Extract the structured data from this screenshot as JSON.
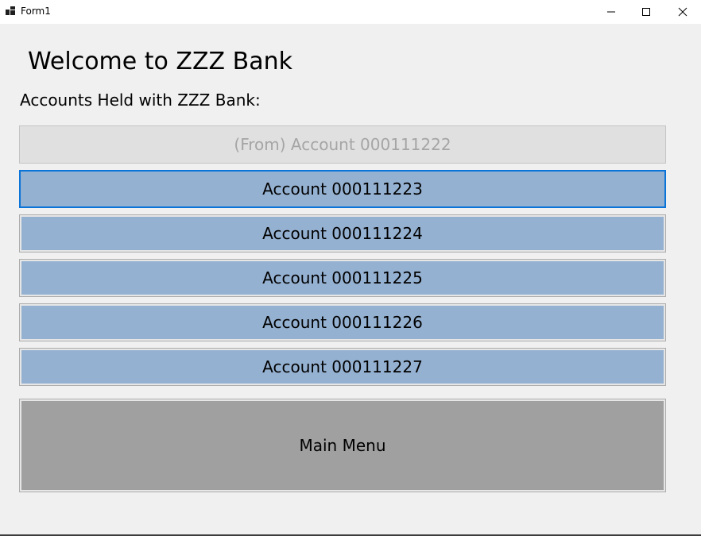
{
  "window": {
    "title": "Form1",
    "controls": {
      "minimize_icon": "minimize-icon",
      "maximize_icon": "maximize-icon",
      "close_icon": "close-icon"
    }
  },
  "main": {
    "heading": "Welcome to ZZZ Bank",
    "subheading": "Accounts Held with ZZZ Bank:",
    "accounts": [
      {
        "label": "(From) Account 000111222",
        "state": "disabled"
      },
      {
        "label": "Account 000111223",
        "state": "focused"
      },
      {
        "label": "Account 000111224",
        "state": "normal"
      },
      {
        "label": "Account 000111225",
        "state": "normal"
      },
      {
        "label": "Account 000111226",
        "state": "normal"
      },
      {
        "label": "Account 000111227",
        "state": "normal"
      }
    ],
    "main_menu_label": "Main Menu"
  },
  "colors": {
    "account_button": "#95b1d1",
    "disabled_button": "#e0e0e0",
    "main_menu_button": "#a0a0a0",
    "focus_border": "#0b74d8"
  }
}
